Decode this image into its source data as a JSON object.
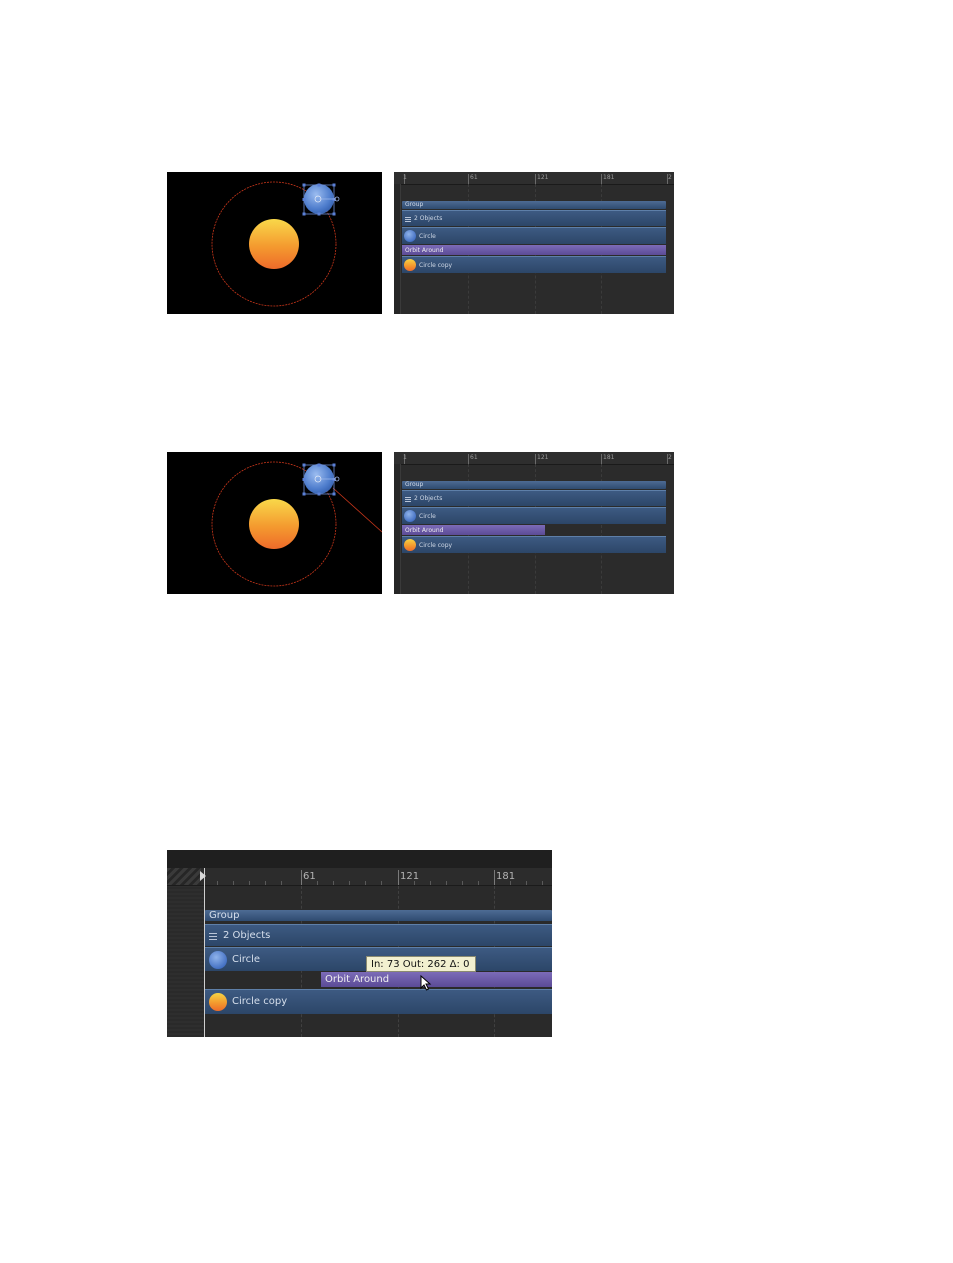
{
  "ruler": {
    "t1": "1",
    "t61": "61",
    "t121": "121",
    "t181": "181",
    "t2": "2"
  },
  "timeline_rows": {
    "group": "Group",
    "objects": "2 Objects",
    "circle": "Circle",
    "behavior": "Orbit Around",
    "circle_copy": "Circle copy"
  },
  "tooltip": {
    "text": "In: 73 Out: 262 Δ: 0"
  },
  "colors": {
    "layer_bar": "#3d5a82",
    "behavior_bar": "#6b5aa8",
    "orbit_path": "#d23a1a",
    "sun_top": "#f7d443",
    "sun_bottom": "#ee6b2a",
    "planet": "#5b86d6"
  },
  "icons": [
    "playhead-icon",
    "layers-list-icon",
    "pointer-cursor-icon",
    "circle-thumbnail-icon",
    "sun-thumbnail-icon"
  ]
}
